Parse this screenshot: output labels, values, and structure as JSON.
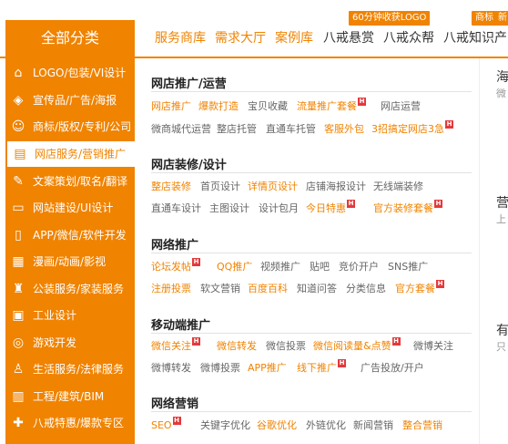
{
  "header": {
    "badge_a": "60分钟收获LOGO",
    "badge_b": "商标",
    "badge_c": "新"
  },
  "nav": {
    "all_label": "全部分类",
    "items": [
      "服务商库",
      "需求大厅",
      "案例库",
      "八戒悬赏",
      "八戒众帮",
      "八戒知识产"
    ]
  },
  "sidebar": {
    "items": [
      {
        "label": "LOGO/包装/VI设计",
        "icon": "tag-icon"
      },
      {
        "label": "宣传品/广告/海报",
        "icon": "megaphone-icon"
      },
      {
        "label": "商标/版权/专利/公司",
        "icon": "user-icon"
      },
      {
        "label": "网店服务/营销推广",
        "icon": "store-icon"
      },
      {
        "label": "文案策划/取名/翻译",
        "icon": "edit-icon"
      },
      {
        "label": "网站建设/UI设计",
        "icon": "monitor-icon"
      },
      {
        "label": "APP/微信/软件开发",
        "icon": "phone-icon"
      },
      {
        "label": "漫画/动画/影视",
        "icon": "film-icon"
      },
      {
        "label": "公装服务/家装服务",
        "icon": "brush-icon"
      },
      {
        "label": "工业设计",
        "icon": "cube-icon"
      },
      {
        "label": "游戏开发",
        "icon": "gamepad-icon"
      },
      {
        "label": "生活服务/法律服务",
        "icon": "person-icon"
      },
      {
        "label": "工程/建筑/BIM",
        "icon": "building-icon"
      },
      {
        "label": "八戒特惠/爆款专区",
        "icon": "gift-icon"
      }
    ]
  },
  "panel": {
    "sections": [
      {
        "title": "网店推广/运营",
        "links": [
          {
            "text": "网店推广",
            "hot": false
          },
          {
            "text": "爆款打造",
            "hot": false
          },
          {
            "text": "宝贝收藏",
            "hot": false
          },
          {
            "text": "流量推广套餐",
            "hot": true
          },
          {
            "text": "网店运营",
            "hot": false
          },
          {
            "text": "微商城代运营",
            "hot": false
          },
          {
            "text": "整店托管",
            "hot": false
          },
          {
            "text": "直通车托管",
            "hot": false
          },
          {
            "text": "客服外包",
            "hot": false
          },
          {
            "text": "3招搞定网店3急",
            "hot": true
          }
        ]
      },
      {
        "title": "网店装修/设计",
        "links": [
          {
            "text": "整店装修",
            "hot": false
          },
          {
            "text": "首页设计",
            "hot": false
          },
          {
            "text": "详情页设计",
            "hot": false
          },
          {
            "text": "店铺海报设计",
            "hot": false
          },
          {
            "text": "无线端装修",
            "hot": false
          },
          {
            "text": "直通车设计",
            "hot": false
          },
          {
            "text": "主图设计",
            "hot": false
          },
          {
            "text": "设计包月",
            "hot": false
          },
          {
            "text": "今日特惠",
            "hot": true
          },
          {
            "text": "官方装修套餐",
            "hot": true
          }
        ]
      },
      {
        "title": "网络推广",
        "links": [
          {
            "text": "论坛发帖",
            "hot": true
          },
          {
            "text": "QQ推广",
            "hot": false
          },
          {
            "text": "视频推广",
            "hot": false
          },
          {
            "text": "贴吧",
            "hot": false
          },
          {
            "text": "竞价开户",
            "hot": false
          },
          {
            "text": "SNS推广",
            "hot": false
          },
          {
            "text": "注册投票",
            "hot": false
          },
          {
            "text": "软文营销",
            "hot": false
          },
          {
            "text": "百度百科",
            "hot": false
          },
          {
            "text": "知道问答",
            "hot": false
          },
          {
            "text": "分类信息",
            "hot": false
          },
          {
            "text": "官方套餐",
            "hot": true
          }
        ]
      },
      {
        "title": "移动端推广",
        "links": [
          {
            "text": "微信关注",
            "hot": true
          },
          {
            "text": "微信转发",
            "hot": false
          },
          {
            "text": "微信投票",
            "hot": false
          },
          {
            "text": "微信阅读量&点赞",
            "hot": true
          },
          {
            "text": "微博关注",
            "hot": false
          },
          {
            "text": "微博转发",
            "hot": false
          },
          {
            "text": "微博投票",
            "hot": false
          },
          {
            "text": "APP推广",
            "hot": false
          },
          {
            "text": "线下推广",
            "hot": true
          },
          {
            "text": "广告投放/开户",
            "hot": false
          }
        ]
      },
      {
        "title": "网络营销",
        "links": [
          {
            "text": "SEO",
            "hot": true
          },
          {
            "text": "关键字优化",
            "hot": false
          },
          {
            "text": "谷歌优化",
            "hot": false
          },
          {
            "text": "外链优化",
            "hot": false
          },
          {
            "text": "新闻营销",
            "hot": false
          },
          {
            "text": "整合营销",
            "hot": false
          }
        ]
      }
    ]
  },
  "right_panel": {
    "items": [
      {
        "title": "海",
        "sub": "微"
      },
      {
        "title": "营",
        "sub": "上"
      },
      {
        "title": "有",
        "sub": "只"
      }
    ]
  },
  "colors": {
    "brand_orange": "#f08300",
    "hot_red": "#e4393c"
  }
}
